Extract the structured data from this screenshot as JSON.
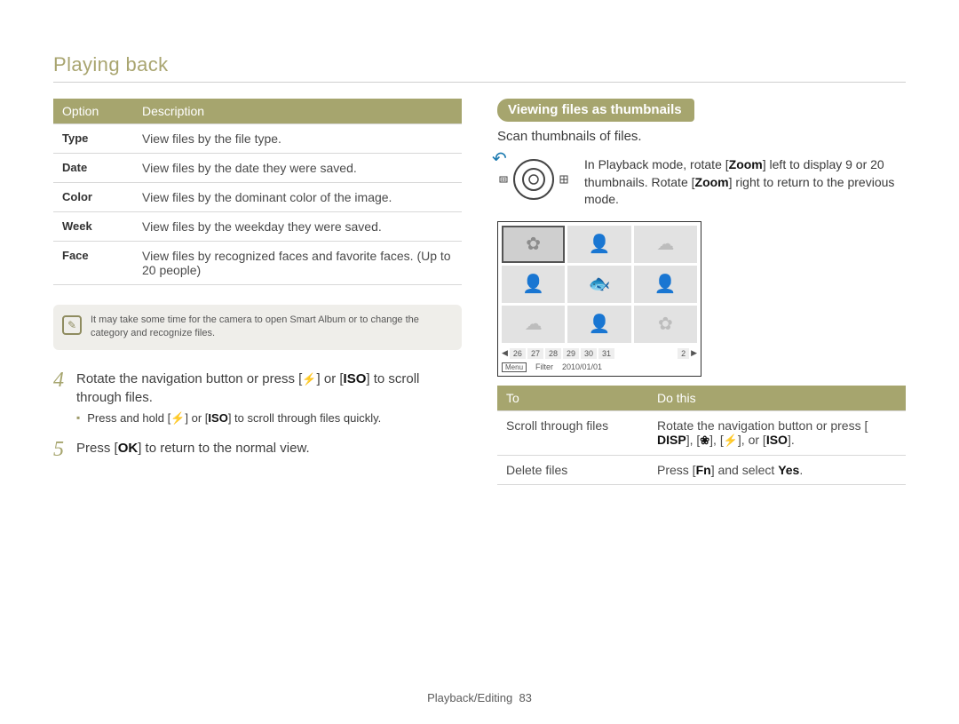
{
  "header": {
    "title": "Playing back"
  },
  "left_table": {
    "head": {
      "c1": "Option",
      "c2": "Description"
    },
    "rows": [
      {
        "opt": "Type",
        "desc": "View files by the file type."
      },
      {
        "opt": "Date",
        "desc": "View files by the date they were saved."
      },
      {
        "opt": "Color",
        "desc": "View files by the dominant color of the image."
      },
      {
        "opt": "Week",
        "desc": "View files by the weekday they were saved."
      },
      {
        "opt": "Face",
        "desc": "View files by recognized faces and favorite faces. (Up to 20 people)"
      }
    ]
  },
  "note": {
    "text": "It may take some time for the camera to open Smart Album or to change the category and recognize files."
  },
  "steps": {
    "s4": {
      "num": "4",
      "pre": "Rotate the navigation button or press [",
      "mid": "] or [",
      "post": "] to scroll through files.",
      "iso": "ISO",
      "sub_pre": "Press and hold [",
      "sub_mid": "] or [",
      "sub_post": "] to scroll through files quickly."
    },
    "s5": {
      "num": "5",
      "pre": "Press [",
      "ok": "OK",
      "post": "] to return to the normal view."
    }
  },
  "right": {
    "pill": "Viewing files as thumbnails",
    "sub": "Scan thumbnails of files.",
    "dial": {
      "l1a": "In Playback mode, rotate [",
      "zoom": "Zoom",
      "l1b": "] left to display 9 or 20 thumbnails. Rotate [",
      "l1c": "] right to return to the previous mode."
    },
    "filmstrip": {
      "cells": [
        "26",
        "27",
        "28",
        "29",
        "30",
        "31",
        "2"
      ]
    },
    "screen_footer": {
      "menu": "Menu",
      "filter": "Filter",
      "date": "2010/01/01"
    },
    "table": {
      "head": {
        "c1": "To",
        "c2": "Do this"
      },
      "rows": [
        {
          "to": "Scroll through files",
          "do_pre": "Rotate the navigation button or press [",
          "disp": "DISP",
          "do_mid1": "], [",
          "do_mid2": "], [",
          "do_mid3": "], or [",
          "iso": "ISO",
          "do_post": "]."
        },
        {
          "to": "Delete files",
          "do_pre": "Press [",
          "fn": "Fn",
          "do_mid": "] and select ",
          "yes": "Yes",
          "do_post": "."
        }
      ]
    }
  },
  "footer": {
    "section": "Playback/Editing",
    "page": "83"
  }
}
